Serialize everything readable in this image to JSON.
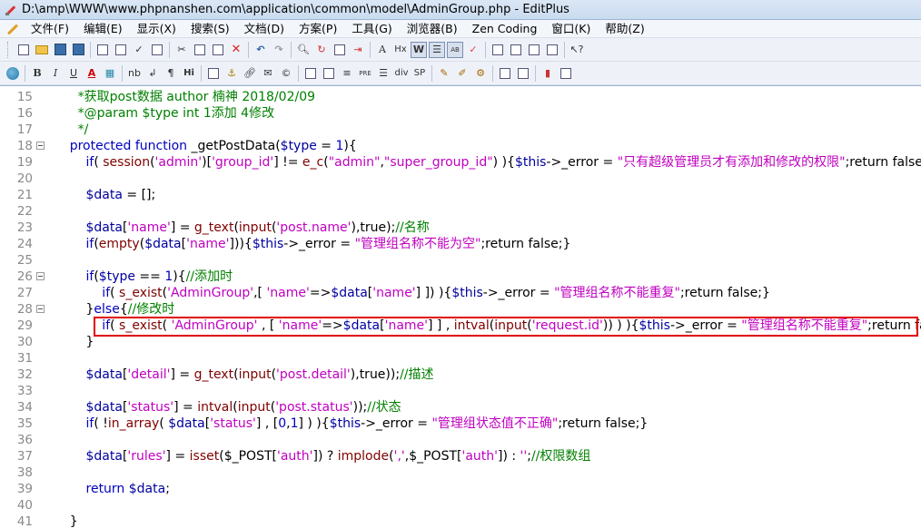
{
  "window": {
    "title": "D:\\amp\\WWW\\www.phpnanshen.com\\application\\common\\model\\AdminGroup.php - EditPlus"
  },
  "menu": [
    "文件(F)",
    "编辑(E)",
    "显示(X)",
    "搜索(S)",
    "文档(D)",
    "方案(P)",
    "工具(G)",
    "浏览器(B)",
    "Zen Coding",
    "窗口(K)",
    "帮助(Z)"
  ],
  "toolbar2_labels": {
    "bold": "B",
    "italic": "I",
    "underline": "U",
    "font_color": "A",
    "nbsp": "nb",
    "br": "↲",
    "para": "¶",
    "hr": "Hi",
    "pre": "PRE",
    "div": "div",
    "span": "SP",
    "font": "A",
    "heading": "Hx"
  },
  "editor": {
    "lines": [
      {
        "n": "15",
        "fold": false,
        "segs": [
          [
            "c-comment",
            "        *获取post数据 author 楠神 2018/02/09"
          ]
        ]
      },
      {
        "n": "16",
        "fold": false,
        "segs": [
          [
            "c-comment",
            "        *@param $type int 1添加 4修改"
          ]
        ]
      },
      {
        "n": "17",
        "fold": false,
        "segs": [
          [
            "c-comment",
            "        */"
          ]
        ]
      },
      {
        "n": "18",
        "fold": true,
        "segs": [
          [
            "c-kw",
            "      protected function "
          ],
          [
            "c-plain",
            "_getPostData("
          ],
          [
            "c-var",
            "$type"
          ],
          [
            "c-plain",
            " = "
          ],
          [
            "c-const",
            "1"
          ],
          [
            "c-plain",
            "){"
          ]
        ]
      },
      {
        "n": "19",
        "fold": false,
        "segs": [
          [
            "c-kw",
            "          if"
          ],
          [
            "c-plain",
            "( "
          ],
          [
            "c-fn",
            "session"
          ],
          [
            "c-plain",
            "("
          ],
          [
            "c-str",
            "'admin'"
          ],
          [
            "c-plain",
            ")["
          ],
          [
            "c-str",
            "'group_id'"
          ],
          [
            "c-plain",
            "] != "
          ],
          [
            "c-fn",
            "e_c"
          ],
          [
            "c-plain",
            "("
          ],
          [
            "c-str",
            "\"admin\""
          ],
          [
            "c-plain",
            ","
          ],
          [
            "c-str",
            "\"super_group_id\""
          ],
          [
            "c-plain",
            ") ){"
          ],
          [
            "c-var",
            "$this"
          ],
          [
            "c-plain",
            "->_error = "
          ],
          [
            "c-str",
            "\"只有超级管理员才有添加和修改的权限\""
          ],
          [
            "c-plain",
            ";return false;}"
          ]
        ]
      },
      {
        "n": "20",
        "fold": false,
        "segs": []
      },
      {
        "n": "21",
        "fold": false,
        "segs": [
          [
            "c-var",
            "          $data"
          ],
          [
            "c-plain",
            " = [];"
          ]
        ]
      },
      {
        "n": "22",
        "fold": false,
        "segs": []
      },
      {
        "n": "23",
        "fold": false,
        "segs": [
          [
            "c-var",
            "          $data"
          ],
          [
            "c-plain",
            "["
          ],
          [
            "c-str",
            "'name'"
          ],
          [
            "c-plain",
            "] = "
          ],
          [
            "c-fn",
            "g_text"
          ],
          [
            "c-plain",
            "("
          ],
          [
            "c-fn",
            "input"
          ],
          [
            "c-plain",
            "("
          ],
          [
            "c-str",
            "'post.name'"
          ],
          [
            "c-plain",
            "),true);"
          ],
          [
            "c-comment",
            "//名称"
          ]
        ]
      },
      {
        "n": "24",
        "fold": false,
        "segs": [
          [
            "c-kw",
            "          if"
          ],
          [
            "c-plain",
            "("
          ],
          [
            "c-fn",
            "empty"
          ],
          [
            "c-plain",
            "("
          ],
          [
            "c-var",
            "$data"
          ],
          [
            "c-plain",
            "["
          ],
          [
            "c-str",
            "'name'"
          ],
          [
            "c-plain",
            "])){"
          ],
          [
            "c-var",
            "$this"
          ],
          [
            "c-plain",
            "->_error = "
          ],
          [
            "c-str",
            "\"管理组名称不能为空\""
          ],
          [
            "c-plain",
            ";return false;}"
          ]
        ]
      },
      {
        "n": "25",
        "fold": false,
        "segs": []
      },
      {
        "n": "26",
        "fold": true,
        "segs": [
          [
            "c-kw",
            "          if"
          ],
          [
            "c-plain",
            "("
          ],
          [
            "c-var",
            "$type"
          ],
          [
            "c-plain",
            " == "
          ],
          [
            "c-const",
            "1"
          ],
          [
            "c-plain",
            "){"
          ],
          [
            "c-comment",
            "//添加时"
          ]
        ]
      },
      {
        "n": "27",
        "fold": false,
        "segs": [
          [
            "c-kw",
            "              if"
          ],
          [
            "c-plain",
            "( "
          ],
          [
            "c-fn",
            "s_exist"
          ],
          [
            "c-plain",
            "("
          ],
          [
            "c-str",
            "'AdminGroup'"
          ],
          [
            "c-plain",
            ",[ "
          ],
          [
            "c-str",
            "'name'"
          ],
          [
            "c-plain",
            "=>"
          ],
          [
            "c-var",
            "$data"
          ],
          [
            "c-plain",
            "["
          ],
          [
            "c-str",
            "'name'"
          ],
          [
            "c-plain",
            "] ]) ){"
          ],
          [
            "c-var",
            "$this"
          ],
          [
            "c-plain",
            "->_error = "
          ],
          [
            "c-str",
            "\"管理组名称不能重复\""
          ],
          [
            "c-plain",
            ";return false;}"
          ]
        ]
      },
      {
        "n": "28",
        "fold": true,
        "segs": [
          [
            "c-plain",
            "          }"
          ],
          [
            "c-kw",
            "else"
          ],
          [
            "c-plain",
            "{"
          ],
          [
            "c-comment",
            "//修改时"
          ]
        ]
      },
      {
        "n": "29",
        "fold": false,
        "segs": [
          [
            "c-kw",
            "              if"
          ],
          [
            "c-plain",
            "( "
          ],
          [
            "c-fn",
            "s_exist"
          ],
          [
            "c-plain",
            "( "
          ],
          [
            "c-str",
            "'AdminGroup'"
          ],
          [
            "c-plain",
            " , [ "
          ],
          [
            "c-str",
            "'name'"
          ],
          [
            "c-plain",
            "=>"
          ],
          [
            "c-var",
            "$data"
          ],
          [
            "c-plain",
            "["
          ],
          [
            "c-str",
            "'name'"
          ],
          [
            "c-plain",
            "] ] , "
          ],
          [
            "c-fn",
            "intval"
          ],
          [
            "c-plain",
            "("
          ],
          [
            "c-fn",
            "input"
          ],
          [
            "c-plain",
            "("
          ],
          [
            "c-str",
            "'request.id'"
          ],
          [
            "c-plain",
            ")) ) ){"
          ],
          [
            "c-var",
            "$this"
          ],
          [
            "c-plain",
            "->_error = "
          ],
          [
            "c-str",
            "\"管理组名称不能重复\""
          ],
          [
            "c-plain",
            ";return false;}"
          ]
        ]
      },
      {
        "n": "30",
        "fold": false,
        "segs": [
          [
            "c-plain",
            "          }"
          ]
        ]
      },
      {
        "n": "31",
        "fold": false,
        "segs": []
      },
      {
        "n": "32",
        "fold": false,
        "segs": [
          [
            "c-var",
            "          $data"
          ],
          [
            "c-plain",
            "["
          ],
          [
            "c-str",
            "'detail'"
          ],
          [
            "c-plain",
            "] = "
          ],
          [
            "c-fn",
            "g_text"
          ],
          [
            "c-plain",
            "("
          ],
          [
            "c-fn",
            "input"
          ],
          [
            "c-plain",
            "("
          ],
          [
            "c-str",
            "'post.detail'"
          ],
          [
            "c-plain",
            "),true));"
          ],
          [
            "c-comment",
            "//描述"
          ]
        ]
      },
      {
        "n": "33",
        "fold": false,
        "segs": []
      },
      {
        "n": "34",
        "fold": false,
        "segs": [
          [
            "c-var",
            "          $data"
          ],
          [
            "c-plain",
            "["
          ],
          [
            "c-str",
            "'status'"
          ],
          [
            "c-plain",
            "] = "
          ],
          [
            "c-fn",
            "intval"
          ],
          [
            "c-plain",
            "("
          ],
          [
            "c-fn",
            "input"
          ],
          [
            "c-plain",
            "("
          ],
          [
            "c-str",
            "'post.status'"
          ],
          [
            "c-plain",
            "));"
          ],
          [
            "c-comment",
            "//状态"
          ]
        ]
      },
      {
        "n": "35",
        "fold": false,
        "segs": [
          [
            "c-kw",
            "          if"
          ],
          [
            "c-plain",
            "( !"
          ],
          [
            "c-fn",
            "in_array"
          ],
          [
            "c-plain",
            "( "
          ],
          [
            "c-var",
            "$data"
          ],
          [
            "c-plain",
            "["
          ],
          [
            "c-str",
            "'status'"
          ],
          [
            "c-plain",
            "] , ["
          ],
          [
            "c-const",
            "0"
          ],
          [
            "c-plain",
            ","
          ],
          [
            "c-const",
            "1"
          ],
          [
            "c-plain",
            "] ) ){"
          ],
          [
            "c-var",
            "$this"
          ],
          [
            "c-plain",
            "->_error = "
          ],
          [
            "c-str",
            "\"管理组状态值不正确\""
          ],
          [
            "c-plain",
            ";return false;}"
          ]
        ]
      },
      {
        "n": "36",
        "fold": false,
        "segs": []
      },
      {
        "n": "37",
        "fold": false,
        "segs": [
          [
            "c-var",
            "          $data"
          ],
          [
            "c-plain",
            "["
          ],
          [
            "c-str",
            "'rules'"
          ],
          [
            "c-plain",
            "] = "
          ],
          [
            "c-fn",
            "isset"
          ],
          [
            "c-plain",
            "($_POST["
          ],
          [
            "c-str",
            "'auth'"
          ],
          [
            "c-plain",
            "]) ? "
          ],
          [
            "c-fn",
            "implode"
          ],
          [
            "c-plain",
            "("
          ],
          [
            "c-str",
            "','"
          ],
          [
            "c-plain",
            ",$_POST["
          ],
          [
            "c-str",
            "'auth'"
          ],
          [
            "c-plain",
            "]) : "
          ],
          [
            "c-str",
            "''"
          ],
          [
            "c-plain",
            ";"
          ],
          [
            "c-comment",
            "//权限数组"
          ]
        ]
      },
      {
        "n": "38",
        "fold": false,
        "segs": []
      },
      {
        "n": "39",
        "fold": false,
        "segs": [
          [
            "c-kw",
            "          return "
          ],
          [
            "c-var",
            "$data"
          ],
          [
            "c-plain",
            ";"
          ]
        ]
      },
      {
        "n": "40",
        "fold": false,
        "segs": []
      },
      {
        "n": "41",
        "fold": false,
        "segs": [
          [
            "c-plain",
            "      }"
          ]
        ]
      }
    ]
  }
}
